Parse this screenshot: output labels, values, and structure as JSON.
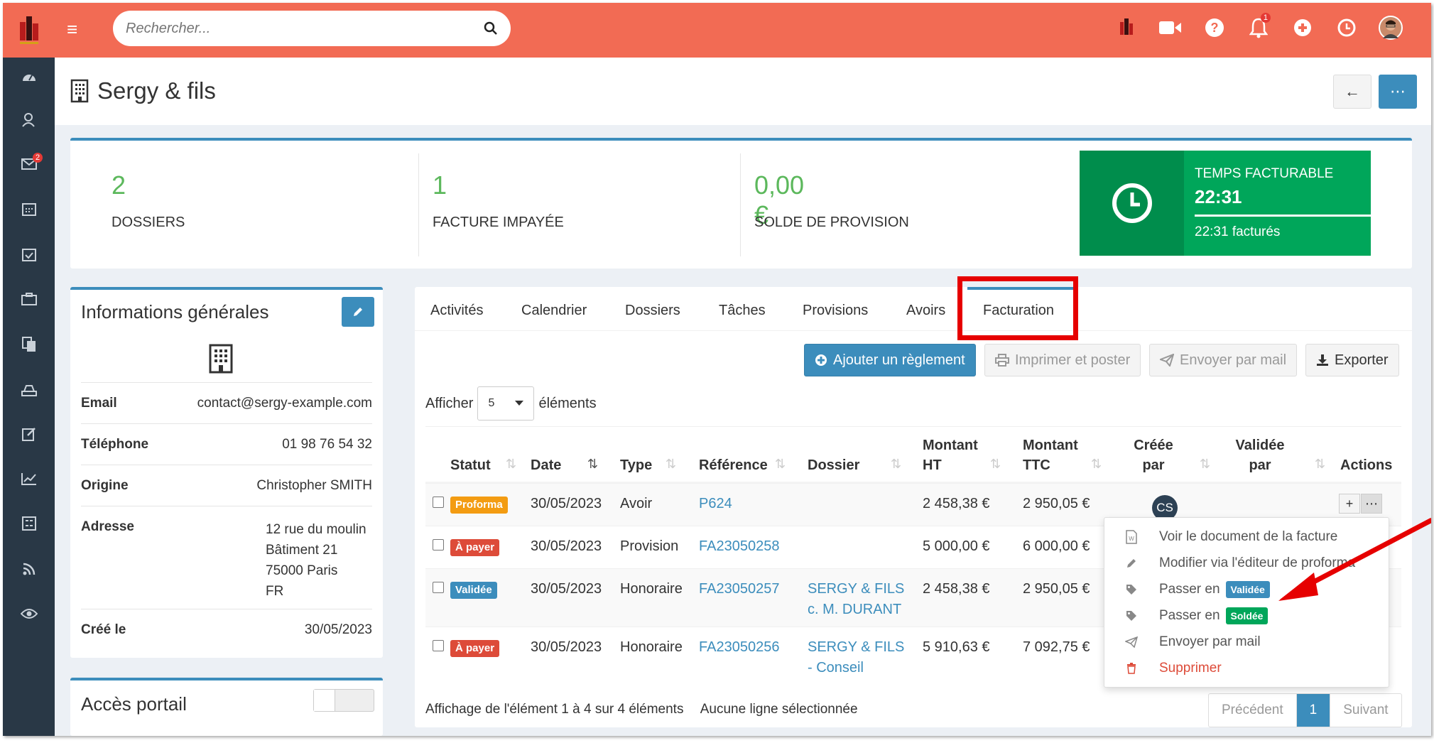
{
  "search": {
    "placeholder": "Rechercher..."
  },
  "topbar": {
    "notif_count": "1"
  },
  "sidebar": {
    "mail_badge": "2"
  },
  "page": {
    "title": "Sergy & fils"
  },
  "stats": [
    {
      "value": "2",
      "label": "DOSSIERS"
    },
    {
      "value": "1",
      "label": "FACTURE IMPAYÉE"
    },
    {
      "value": "0,00 €",
      "label": "SOLDE DE PROVISION"
    }
  ],
  "temps": {
    "title": "TEMPS FACTURABLE",
    "value": "22:31",
    "sub": "22:31 facturés"
  },
  "info": {
    "title": "Informations générales",
    "rows": [
      {
        "k": "Email",
        "v": "contact@sergy-example.com"
      },
      {
        "k": "Téléphone",
        "v": "01 98 76 54 32"
      },
      {
        "k": "Origine",
        "v": "Christopher SMITH"
      },
      {
        "k": "Adresse",
        "l1": "12 rue du moulin",
        "l2": "Bâtiment 21",
        "l3": "75000 Paris",
        "l4": "FR"
      },
      {
        "k": "Créé le",
        "v": "30/05/2023"
      }
    ]
  },
  "portal": {
    "title": "Accès portail"
  },
  "tabs": [
    "Activités",
    "Calendrier",
    "Dossiers",
    "Tâches",
    "Provisions",
    "Avoirs",
    "Facturation"
  ],
  "actions": {
    "add": "Ajouter un règlement",
    "print": "Imprimer et poster",
    "mail": "Envoyer par mail",
    "export": "Exporter"
  },
  "afficher": {
    "before": "Afficher",
    "value": "5",
    "after": "éléments"
  },
  "columns": {
    "statut": "Statut",
    "date": "Date",
    "type": "Type",
    "reference": "Référence",
    "dossier": "Dossier",
    "ht1": "Montant",
    "ht2": "HT",
    "ttc1": "Montant",
    "ttc2": "TTC",
    "creee1": "Créée",
    "creee2": "par",
    "validee1": "Validée",
    "validee2": "par",
    "actions": "Actions"
  },
  "rows": [
    {
      "statut": "Proforma",
      "color": "#f39c12",
      "date": "30/05/2023",
      "type": "Avoir",
      "ref": "P624",
      "dossier1": "",
      "dossier2": "",
      "ht": "2 458,38 €",
      "ttc": "2 950,05 €",
      "creee": "CS"
    },
    {
      "statut": "À payer",
      "color": "#dd4b39",
      "date": "30/05/2023",
      "type": "Provision",
      "ref": "FA23050258",
      "dossier1": "",
      "dossier2": "",
      "ht": "5 000,00 €",
      "ttc": "6 000,00 €",
      "creee": ""
    },
    {
      "statut": "Validée",
      "color": "#3c8dbc",
      "date": "30/05/2023",
      "type": "Honoraire",
      "ref": "FA23050257",
      "dossier1": "SERGY & FILS",
      "dossier2": "c. M. DURANT",
      "ht": "2 458,38 €",
      "ttc": "2 950,05 €",
      "creee": ""
    },
    {
      "statut": "À payer",
      "color": "#dd4b39",
      "date": "30/05/2023",
      "type": "Honoraire",
      "ref": "FA23050256",
      "dossier1": "SERGY & FILS",
      "dossier2": "- Conseil",
      "ht": "5 910,63 €",
      "ttc": "7 092,75 €",
      "creee": ""
    }
  ],
  "footer": {
    "info": "Affichage de l'élément 1 à 4 sur 4 éléments",
    "selection": "Aucune ligne sélectionnée",
    "prev": "Précédent",
    "page": "1",
    "next": "Suivant"
  },
  "dropdown": {
    "voir": "Voir le document de la facture",
    "modifier": "Modifier via l'éditeur de proforma",
    "passer": "Passer en",
    "validee": "Validée",
    "soldee": "Soldée",
    "envoyer": "Envoyer par mail",
    "supprimer": "Supprimer"
  }
}
